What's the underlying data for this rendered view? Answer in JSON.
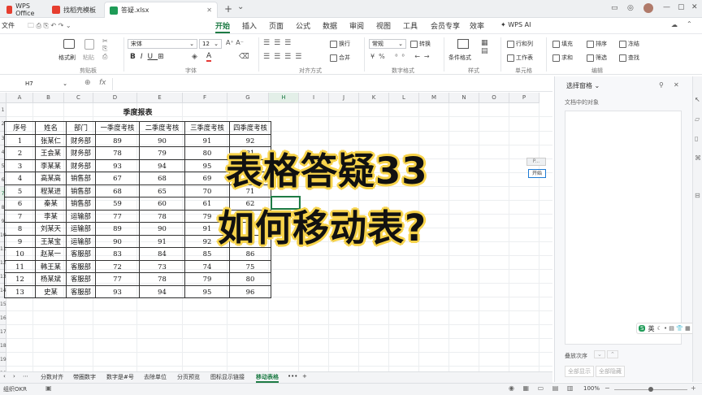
{
  "titlebar": {
    "tabs": [
      {
        "label": "WPS Office",
        "color": "#e63e2f"
      },
      {
        "label": "找稻壳模板",
        "color": "#e63e2f"
      },
      {
        "label": "答疑.xlsx",
        "color": "#1e9b57"
      }
    ],
    "new_tab": "+",
    "dropdown": "⌄"
  },
  "menubar": {
    "file": "文件",
    "items": [
      "开始",
      "插入",
      "页面",
      "公式",
      "数据",
      "审阅",
      "视图",
      "工具",
      "会员专享",
      "效率"
    ],
    "active": "开始",
    "wps_ai": "WPS AI"
  },
  "ribbon": {
    "format_painter": "格式刷",
    "paste": "粘贴",
    "clipboard_group": "剪贴板",
    "font_name": "宋体",
    "font_size": "12",
    "font_group": "字体",
    "wrap": "换行",
    "merge": "合并",
    "align_group": "对齐方式",
    "number_format": "常规",
    "convert": "转换",
    "number_group": "数字格式",
    "cond_format": "条件格式",
    "style_group": "样式",
    "row_col": "行和列",
    "worksheet": "工作表",
    "cell_group": "单元格",
    "fill": "填充",
    "sort": "排序",
    "freeze": "冻结",
    "sum": "求和",
    "filter": "筛选",
    "find": "查找",
    "edit_group": "编辑"
  },
  "formula_bar": {
    "cell_ref": "H7",
    "fx": "fx",
    "value": ""
  },
  "columns": [
    "A",
    "B",
    "C",
    "D",
    "E",
    "F",
    "G",
    "H",
    "I",
    "J",
    "K",
    "L",
    "M",
    "N",
    "O",
    "P"
  ],
  "rows": [
    "1",
    "2",
    "3",
    "4",
    "5",
    "6",
    "7",
    "8",
    "9",
    "10",
    "11",
    "12",
    "13",
    "14",
    "15",
    "16",
    "17",
    "18",
    "19",
    "20",
    "21",
    "22"
  ],
  "sheet": {
    "title": "季度报表",
    "headers": [
      "序号",
      "姓名",
      "部门",
      "一季度考核",
      "二季度考核",
      "三季度考核",
      "四季度考核"
    ],
    "data": [
      [
        "1",
        "张某仁",
        "财务部",
        "89",
        "90",
        "91",
        "92"
      ],
      [
        "2",
        "王会某",
        "财务部",
        "78",
        "79",
        "80",
        "81"
      ],
      [
        "3",
        "李某某",
        "财务部",
        "93",
        "94",
        "95",
        "96"
      ],
      [
        "4",
        "高某高",
        "销售部",
        "67",
        "68",
        "69",
        "70"
      ],
      [
        "5",
        "程某进",
        "销售部",
        "68",
        "65",
        "70",
        "71"
      ],
      [
        "6",
        "秦某",
        "销售部",
        "59",
        "60",
        "61",
        "62"
      ],
      [
        "7",
        "李某",
        "运输部",
        "77",
        "78",
        "79",
        "80"
      ],
      [
        "8",
        "刘某天",
        "运输部",
        "89",
        "90",
        "91",
        "92"
      ],
      [
        "9",
        "王某宝",
        "运输部",
        "90",
        "91",
        "92",
        "93"
      ],
      [
        "10",
        "赵某一",
        "客服部",
        "83",
        "84",
        "85",
        "86"
      ],
      [
        "11",
        "韩王某",
        "客服部",
        "72",
        "73",
        "74",
        "75"
      ],
      [
        "12",
        "杨某斌",
        "客服部",
        "77",
        "78",
        "79",
        "80"
      ],
      [
        "13",
        "史某",
        "客服部",
        "93",
        "94",
        "95",
        "96"
      ]
    ]
  },
  "overlay": {
    "line1": "表格答疑33",
    "line2": "如何移动表?"
  },
  "float_button": {
    "label": "开始",
    "small": "P..."
  },
  "pane": {
    "title": "选择窗格",
    "subtitle": "文档中的对象",
    "order": "叠放次序",
    "show_all": "全部显示",
    "hide_all": "全部隐藏"
  },
  "ime": {
    "label": "英"
  },
  "sheet_tabs": [
    "分数对齐",
    "带圈数字",
    "数字是#号",
    "去除单位",
    "分页预览",
    "图标显示链接",
    "移动表格"
  ],
  "active_sheet": "移动表格",
  "status": {
    "left": "组织OKR",
    "zoom": "100%"
  }
}
